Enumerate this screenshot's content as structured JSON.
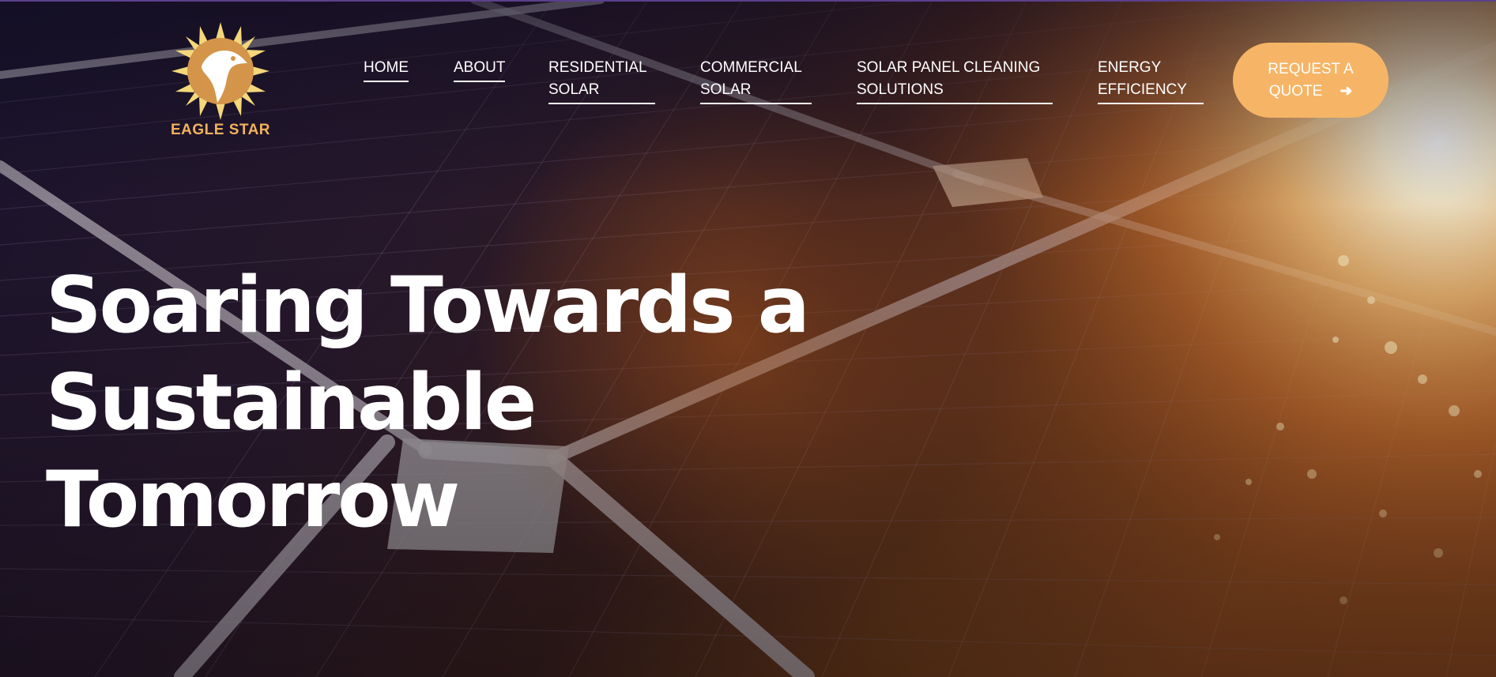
{
  "brand": {
    "name": "EAGLE STAR",
    "logo_icon": "eagle-sun-logo-icon",
    "colors": {
      "logo_gold": "#f2b25b",
      "sun_ray": "#f4d77a",
      "accent": "#f6b566"
    }
  },
  "nav": {
    "items": [
      {
        "line1": "HOME",
        "line2": ""
      },
      {
        "line1": "ABOUT",
        "line2": ""
      },
      {
        "line1": "RESIDENTIAL",
        "line2": "SOLAR"
      },
      {
        "line1": "COMMERCIAL",
        "line2": "SOLAR"
      },
      {
        "line1": "SOLAR PANEL CLEANING",
        "line2": "SOLUTIONS"
      },
      {
        "line1": "ENERGY",
        "line2": "EFFICIENCY"
      }
    ]
  },
  "cta": {
    "line1": "REQUEST A",
    "line2": "QUOTE",
    "icon": "arrow-right-icon"
  },
  "hero": {
    "headline_line1": "Soaring Towards a Sustainable",
    "headline_line2": "Tomorrow",
    "background": "solar-panel-sunset-photo"
  }
}
